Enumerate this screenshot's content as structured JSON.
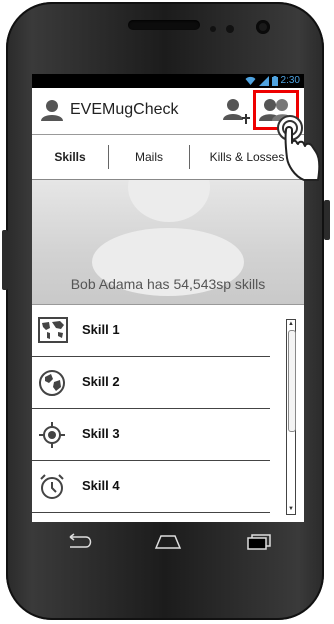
{
  "app": {
    "title": "EVEMugCheck"
  },
  "status_bar": {
    "time": "2:30"
  },
  "tabs": [
    {
      "label": "Skills",
      "active": true
    },
    {
      "label": "Mails",
      "active": false
    },
    {
      "label": "Kills & Losses",
      "active": false
    }
  ],
  "banner": {
    "text": "Bob Adama has 54,543sp skills"
  },
  "skills": [
    {
      "label": "Skill 1",
      "icon": "world-map-icon"
    },
    {
      "label": "Skill 2",
      "icon": "globe-icon"
    },
    {
      "label": "Skill 3",
      "icon": "crosshair-icon"
    },
    {
      "label": "Skill 4",
      "icon": "alarm-clock-icon"
    }
  ],
  "colors": {
    "highlight": "#e00000",
    "status_accent": "#4fa3e0"
  }
}
